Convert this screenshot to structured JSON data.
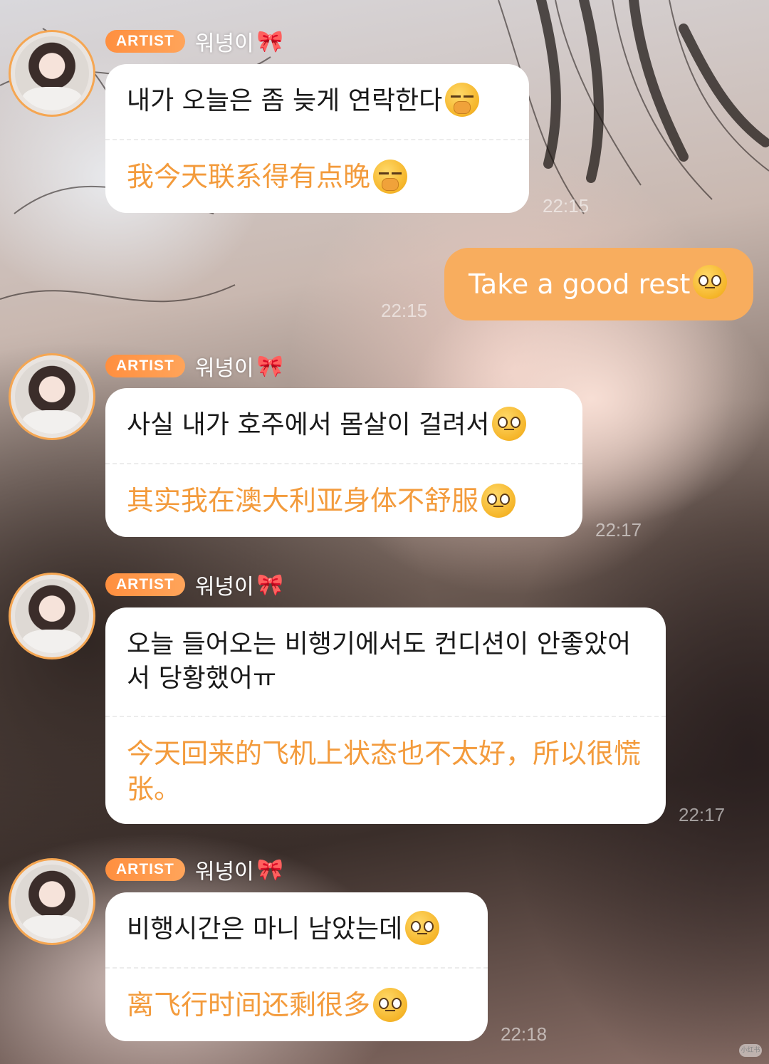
{
  "messages": [
    {
      "badge": "ARTIST",
      "sender": "워녕이",
      "bow": "🎀",
      "korean": "내가 오늘은 좀 늦게 연락한다",
      "chinese": "我今天联系得有点晚",
      "time": "22:15"
    },
    {
      "mine_text": "Take a good rest",
      "mine_time": "22:15"
    },
    {
      "badge": "ARTIST",
      "sender": "워녕이",
      "bow": "🎀",
      "korean": "사실 내가 호주에서 몸살이 걸려서",
      "chinese": "其实我在澳大利亚身体不舒服",
      "time": "22:17"
    },
    {
      "badge": "ARTIST",
      "sender": "워녕이",
      "bow": "🎀",
      "korean": "오늘 들어오는 비행기에서도 컨디션이 안좋았어서 당황했어ㅠ",
      "chinese": "今天回来的飞机上状态也不太好，所以很慌张。",
      "time": "22:17"
    },
    {
      "badge": "ARTIST",
      "sender": "워녕이",
      "bow": "🎀",
      "korean": "비행시간은 마니 남았는데",
      "chinese": "离飞行时间还剩很多",
      "time": "22:18"
    }
  ],
  "icons": {
    "emoji_1": "shushing-face-emoji",
    "emoji_2": "pleading-face-emoji"
  },
  "colors": {
    "accent": "#f8ad5e",
    "badge": "#ff8f3f",
    "translation_text": "#f39b3c"
  },
  "watermark": "小红书"
}
